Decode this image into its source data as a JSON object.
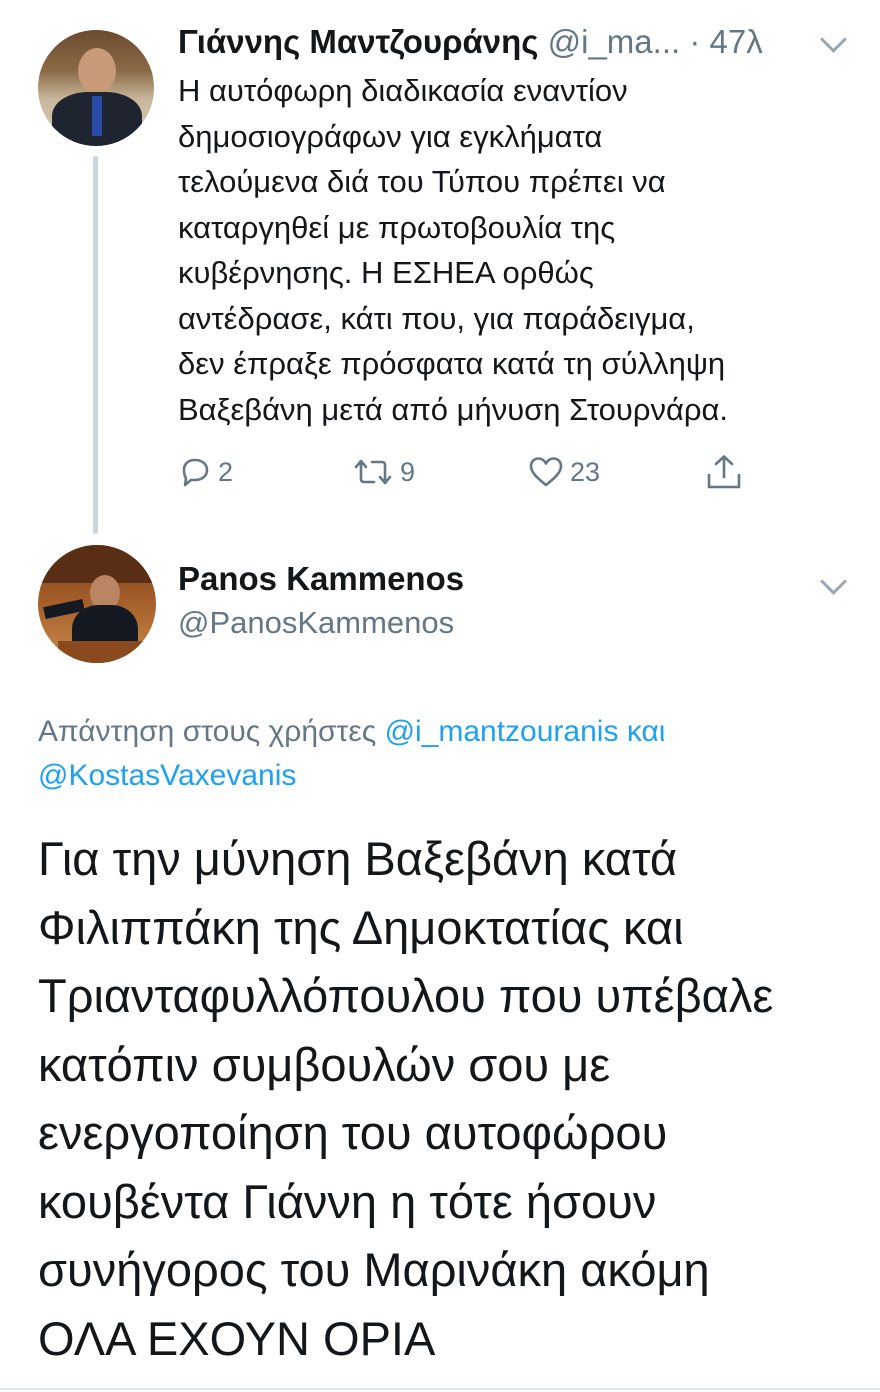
{
  "tweet_original": {
    "author_name": "Γιάννης Μαντζουράνης",
    "author_handle": "@i_ma...",
    "separator": "·",
    "timestamp": "47λ",
    "text": "Η  αυτόφωρη διαδικασία εναντίον\nδημοσιογράφων για εγκλήματα\nτελούμενα διά  του Τύπου πρέπει να\nκαταργηθεί με πρωτοβουλία της\nκυβέρνησης. Η ΕΣΗΕΑ  ορθώς\nαντέδρασε, κάτι που, για παράδειγμα,\nδεν έπραξε πρόσφατα κατά τη  σύλληψη\nΒαξεβάνη μετά από μήνυση Στουρνάρα.",
    "reply_count": "2",
    "retweet_count": "9",
    "like_count": "23",
    "icons": {
      "reply": "reply-icon",
      "retweet": "retweet-icon",
      "like": "heart-icon",
      "share": "share-icon",
      "menu": "chevron-down-icon"
    }
  },
  "tweet_reply": {
    "author_name": "Panos Kammenos",
    "author_handle": "@PanosKammenos",
    "reply_prefix": "Απάντηση στους χρήστες",
    "reply_mention_1": "@i_mantzouranis",
    "reply_conjunction": "και",
    "reply_mention_2": "@KostasVaxevanis",
    "text": "Για την μύνηση Βαξεβάνη κατά\nΦιλιππάκη της Δημοκτατίας και\nΤριανταφυλλόπουλου που υπέβαλε\nκατόπιν συμβουλών σου με\nενεργοποίηση του αυτοφώρου\nκουβέντα Γιάννη η τότε ήσουν\nσυνήγορος του Μαρινάκη ακόμη\nΟΛΑ ΕΧΟΥΝ ΟΡΙΑ"
  },
  "colors": {
    "text_primary": "#14171a",
    "text_secondary": "#657786",
    "link_blue": "#1da1f2",
    "thread_line": "#ccd6dd"
  }
}
